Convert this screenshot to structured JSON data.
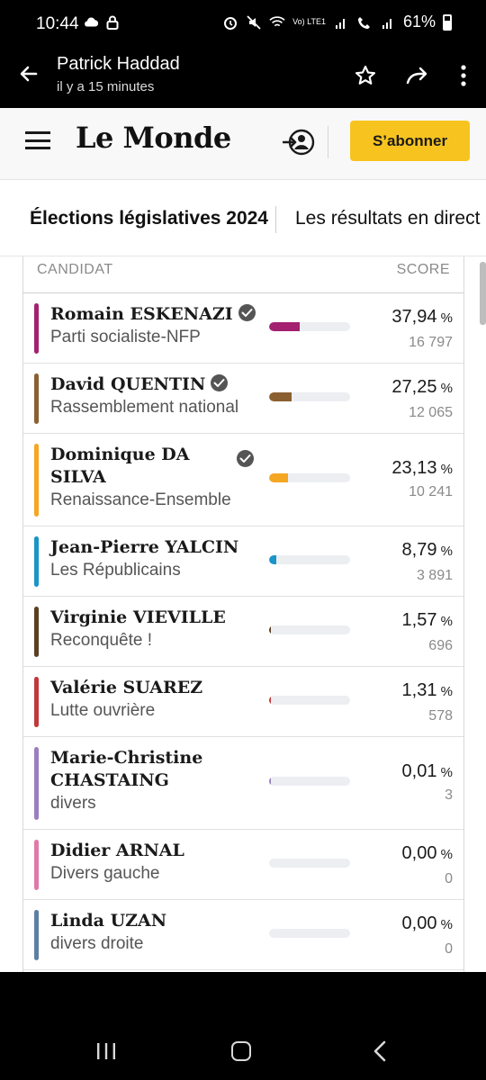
{
  "status_bar": {
    "time": "10:44",
    "network_label": "Vo) LTE1",
    "battery": "61%"
  },
  "app_bar": {
    "title": "Patrick Haddad",
    "subtitle": "il y a 15 minutes"
  },
  "site": {
    "logo": "Le Monde",
    "subscribe_label": "S’abonner"
  },
  "tabs": [
    {
      "label": "Élections législatives 2024"
    },
    {
      "label": "Les résultats en direct"
    }
  ],
  "table": {
    "header": {
      "candidate": "CANDIDAT",
      "score": "SCORE"
    },
    "rows": [
      {
        "name": "Romain ESKENAZI",
        "party": "Parti socialiste-NFP",
        "percent": "37,94",
        "votes": "16 797",
        "share": 0.3794,
        "color": "#a3216f",
        "qualified": true
      },
      {
        "name": "David QUENTIN",
        "party": "Rassemblement national",
        "percent": "27,25",
        "votes": "12 065",
        "share": 0.2725,
        "color": "#8a6031",
        "qualified": true
      },
      {
        "name": "Dominique DA SILVA",
        "party": "Renaissance-Ensemble",
        "percent": "23,13",
        "votes": "10 241",
        "share": 0.2313,
        "color": "#f5a623",
        "qualified": true
      },
      {
        "name": "Jean-Pierre YALCIN",
        "party": "Les Républicains",
        "percent": "8,79",
        "votes": "3 891",
        "share": 0.0879,
        "color": "#1a95c8",
        "qualified": false
      },
      {
        "name": "Virginie VIEVILLE",
        "party": "Reconquête !",
        "percent": "1,57",
        "votes": "696",
        "share": 0.0157,
        "color": "#5a3f22",
        "qualified": false
      },
      {
        "name": "Valérie SUAREZ",
        "party": "Lutte ouvrière",
        "percent": "1,31",
        "votes": "578",
        "share": 0.0131,
        "color": "#c0393b",
        "qualified": false
      },
      {
        "name": "Marie-Christine CHASTAING",
        "party": "divers",
        "percent": "0,01",
        "votes": "3",
        "share": 0.0001,
        "color": "#9b7fc0",
        "qualified": false
      },
      {
        "name": "Didier ARNAL",
        "party": "Divers gauche",
        "percent": "0,00",
        "votes": "0",
        "share": 0,
        "color": "#e07aa8",
        "qualified": false
      },
      {
        "name": "Linda UZAN",
        "party": "divers droite",
        "percent": "0,00",
        "votes": "0",
        "share": 0,
        "color": "#5f7ea3",
        "qualified": false
      }
    ]
  }
}
